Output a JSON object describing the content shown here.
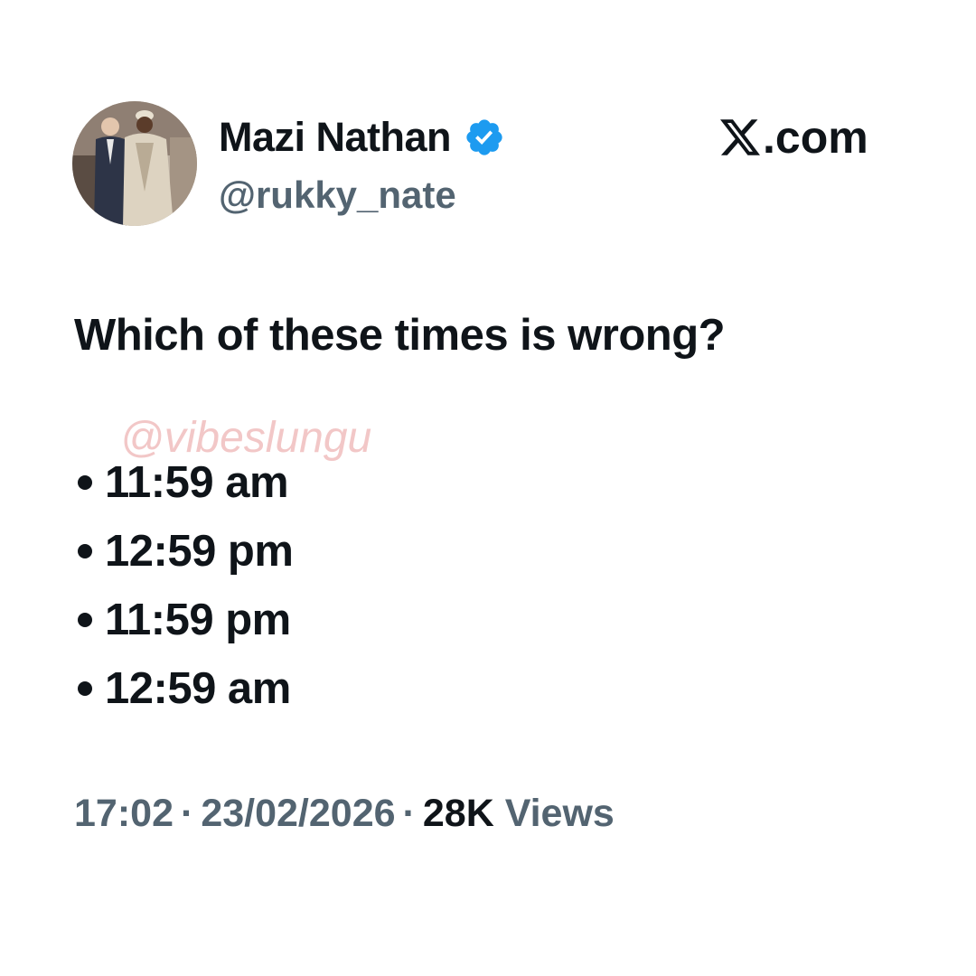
{
  "author": {
    "display_name": "Mazi Nathan",
    "handle": "@rukky_nate",
    "verified_icon": "verified-badge-icon",
    "avatar_icon": "profile-photo"
  },
  "brand": {
    "icon": "x-logo-icon",
    "suffix": ".com"
  },
  "tweet": {
    "question": "Which of these times is wrong?",
    "options": [
      "11:59 am",
      "12:59 pm",
      "11:59 pm",
      "12:59 am"
    ]
  },
  "watermark": "@vibeslungu",
  "meta": {
    "time": "17:02",
    "separator": "·",
    "date": "23/02/2026",
    "views_count": "28K",
    "views_label": "Views"
  },
  "colors": {
    "text_primary": "#0f1419",
    "text_secondary": "#536471",
    "verified_blue": "#1d9bf0",
    "watermark": "#f2c7c7"
  }
}
